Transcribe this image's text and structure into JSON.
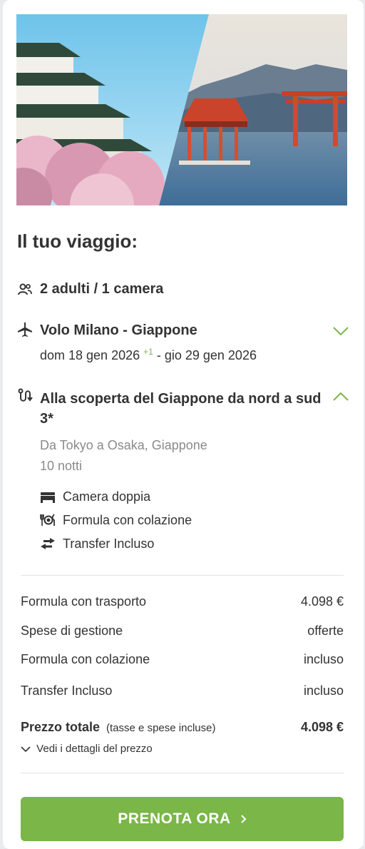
{
  "trip": {
    "title": "Il tuo viaggio:",
    "travellers": "2 adulti / 1 camera",
    "flight": {
      "title": "Volo Milano - Giappone",
      "dates_start": "dom 18 gen 2026",
      "plus": "+1",
      "dates_end": "- gio 29 gen 2026"
    },
    "tour": {
      "title": "Alla scoperta del Giappone da nord a sud 3*",
      "location": "Da Tokyo a Osaka, Giappone",
      "nights": "10 notti",
      "features": [
        {
          "label": "Camera doppia",
          "icon": "bed-icon"
        },
        {
          "label": "Formula con colazione",
          "icon": "dining-icon"
        },
        {
          "label": "Transfer Incluso",
          "icon": "transfer-icon"
        }
      ]
    }
  },
  "pricing": {
    "rows": [
      {
        "label": "Formula con trasporto",
        "value": "4.098 €"
      },
      {
        "label": "Spese di gestione",
        "value": "offerte"
      },
      {
        "label": "Formula con colazione",
        "value": "incluso"
      },
      {
        "label": "Transfer Incluso",
        "value": "incluso"
      }
    ],
    "total_label": "Prezzo totale",
    "total_note": "(tasse e spese incluse)",
    "total_value": "4.098 €",
    "details_link": "Vedi i dettagli del prezzo"
  },
  "cta": {
    "label": "PRENOTA ORA",
    "icon": "chevron-right-icon"
  },
  "colors": {
    "accent": "#7ab648",
    "text": "#333333",
    "muted": "#8a8a8a"
  }
}
